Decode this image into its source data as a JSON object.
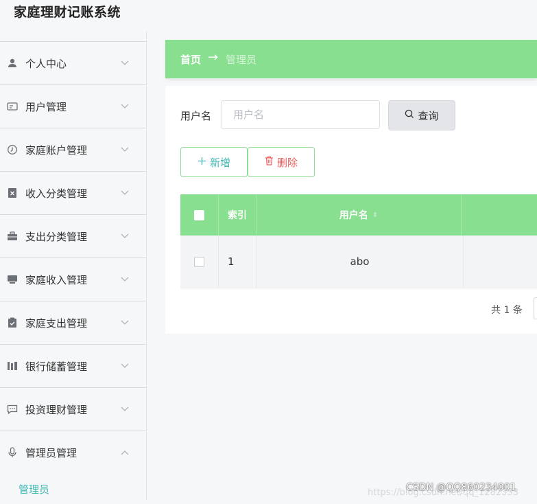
{
  "app": {
    "title": "家庭理财记账系统"
  },
  "sidebar": {
    "items": [
      {
        "label": "个人中心",
        "icon": "user-icon"
      },
      {
        "label": "用户管理",
        "icon": "id-card-icon"
      },
      {
        "label": "家庭账户管理",
        "icon": "clock-icon"
      },
      {
        "label": "收入分类管理",
        "icon": "delete-doc-icon"
      },
      {
        "label": "支出分类管理",
        "icon": "briefcase-icon"
      },
      {
        "label": "家庭收入管理",
        "icon": "monitor-icon"
      },
      {
        "label": "家庭支出管理",
        "icon": "checklist-icon"
      },
      {
        "label": "银行储蓄管理",
        "icon": "bank-icon"
      },
      {
        "label": "投资理财管理",
        "icon": "chat-icon"
      },
      {
        "label": "管理员管理",
        "icon": "microphone-icon",
        "expanded": true
      }
    ],
    "subitems": [
      {
        "label": "管理员"
      }
    ]
  },
  "breadcrumb": {
    "home": "首页",
    "separator": "→",
    "current": "管理员"
  },
  "search": {
    "label": "用户名",
    "placeholder": "用户名",
    "value": "",
    "button": "查询"
  },
  "actions": {
    "add": "新增",
    "delete": "删除"
  },
  "table": {
    "headers": {
      "index": "索引",
      "username": "用户名"
    },
    "rows": [
      {
        "index": "1",
        "username": "abo"
      }
    ]
  },
  "pagination": {
    "total": "共 1 条"
  },
  "watermark": {
    "text": "CSDN @QQ860234001",
    "url": "https://blog.csdn.net/qq_1282353"
  },
  "colors": {
    "accent": "#88df8f",
    "link": "#3fb7b2",
    "danger": "#f05c5c"
  }
}
